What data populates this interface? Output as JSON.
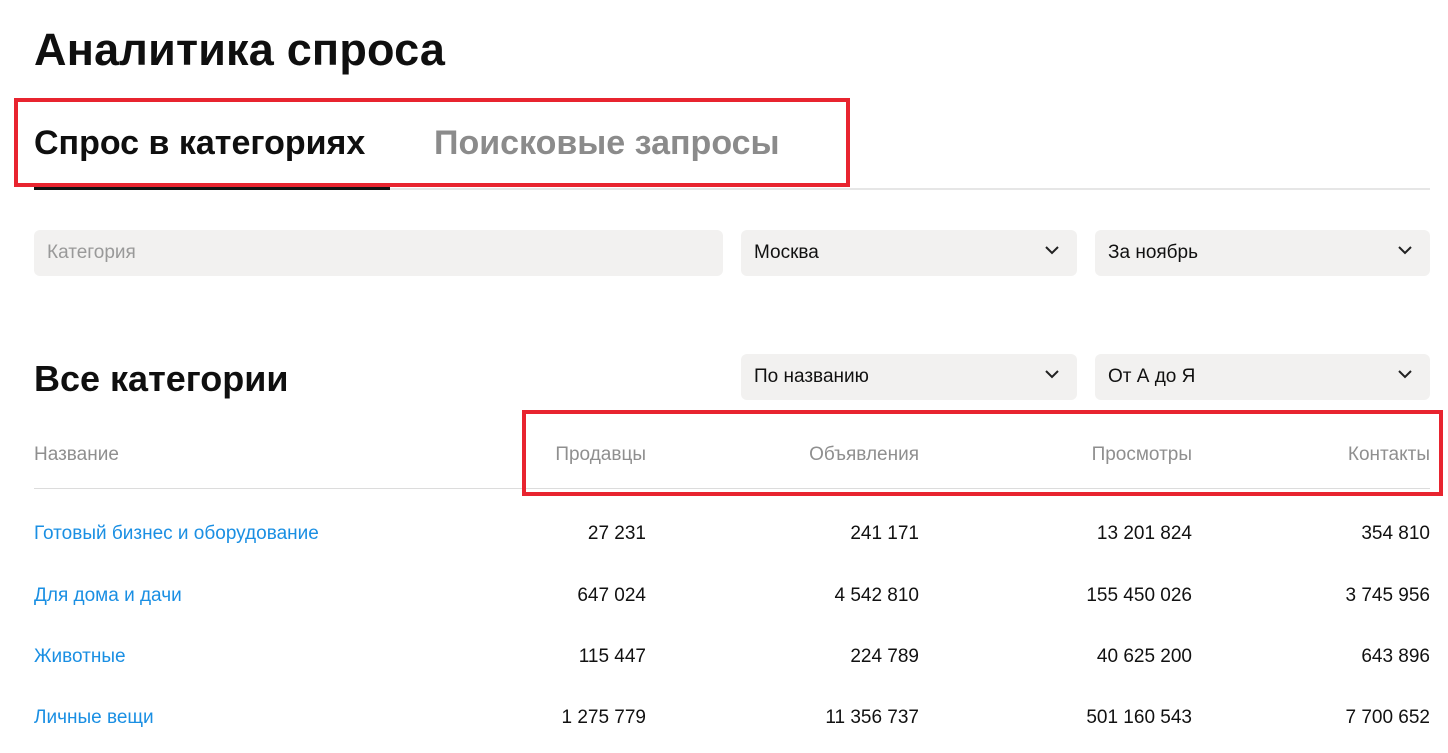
{
  "page": {
    "title": "Аналитика спроса"
  },
  "tabs": [
    {
      "label": "Спрос в категориях",
      "active": true
    },
    {
      "label": "Поисковые запросы",
      "active": false
    }
  ],
  "filters": {
    "category": {
      "placeholder": "Категория",
      "value": ""
    },
    "city": {
      "value": "Москва"
    },
    "period": {
      "value": "За ноябрь"
    }
  },
  "section": {
    "title": "Все категории",
    "sort_by": {
      "value": "По названию"
    },
    "sort_order": {
      "value": "От А до Я"
    }
  },
  "table": {
    "columns": [
      "Название",
      "Продавцы",
      "Объявления",
      "Просмотры",
      "Контакты"
    ],
    "rows": [
      {
        "name": "Готовый бизнес и оборудование",
        "sellers": "27 231",
        "ads": "241 171",
        "views": "13 201 824",
        "contacts": "354 810"
      },
      {
        "name": "Для дома и дачи",
        "sellers": "647 024",
        "ads": "4 542 810",
        "views": "155 450 026",
        "contacts": "3 745 956"
      },
      {
        "name": "Животные",
        "sellers": "115 447",
        "ads": "224 789",
        "views": "40 625 200",
        "contacts": "643 896"
      },
      {
        "name": "Личные вещи",
        "sellers": "1 275 779",
        "ads": "11 356 737",
        "views": "501 160 543",
        "contacts": "7 700 652"
      }
    ]
  },
  "colors": {
    "highlight": "#e8242f",
    "link": "#1a8fe3",
    "field_bg": "#f2f1f0",
    "muted": "#8f8f8f"
  },
  "icons": {
    "dropdown": "chevron-down-icon"
  }
}
